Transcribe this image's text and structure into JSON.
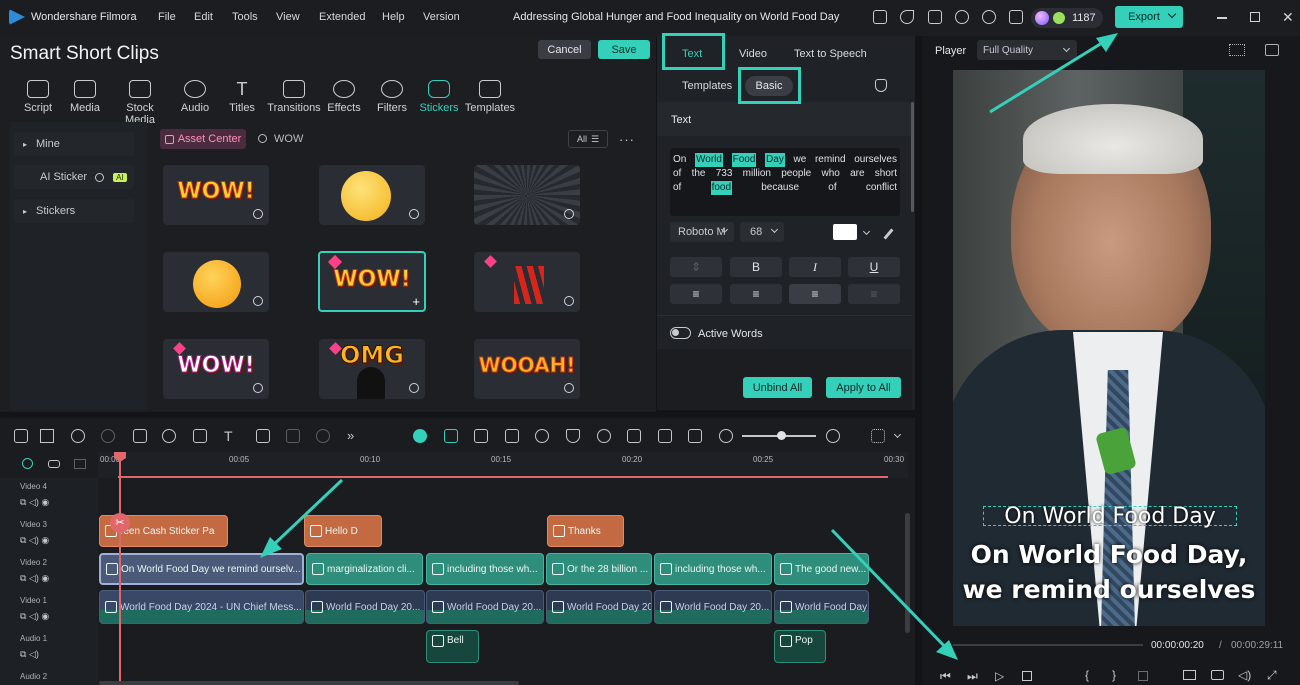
{
  "app": {
    "name": "Wondershare Filmora",
    "project_title": "Addressing Global Hunger and Food Inequality on World Food Day",
    "credits": "1187",
    "export_label": "Export"
  },
  "menu": [
    "File",
    "Edit",
    "Tools",
    "View",
    "Extended",
    "Help",
    "Version"
  ],
  "ssc": {
    "title": "Smart Short Clips",
    "cancel": "Cancel",
    "save": "Save"
  },
  "toolbar": [
    "Script",
    "Media",
    "Stock Media",
    "Audio",
    "Titles",
    "Transitions",
    "Effects",
    "Filters",
    "Stickers",
    "Templates"
  ],
  "sidebar": {
    "mine": "Mine",
    "ai_sticker": "AI Sticker",
    "ai_badge": "AI",
    "stickers": "Stickers"
  },
  "search": {
    "asset_center": "Asset Center",
    "query": "WOW",
    "filter": "All"
  },
  "stickers": [
    "WOW!",
    "",
    "",
    "",
    "WOW!",
    "",
    "WOW!",
    "OMG",
    "WOOAH!"
  ],
  "text_panel": {
    "tabs": [
      "Text",
      "Video",
      "Text to Speech"
    ],
    "subtabs": [
      "Templates",
      "Basic"
    ],
    "section": "Text",
    "words": [
      {
        "w": "On",
        "hl": false
      },
      {
        "w": "World",
        "hl": true
      },
      {
        "w": "Food",
        "hl": true
      },
      {
        "w": "Day",
        "hl": true
      },
      {
        "w": "we",
        "hl": false
      },
      {
        "w": "remind",
        "hl": false
      },
      {
        "w": "ourselves",
        "hl": false
      },
      {
        "w": "of",
        "hl": false
      },
      {
        "w": "the",
        "hl": false
      },
      {
        "w": "733",
        "hl": false
      },
      {
        "w": "million",
        "hl": false
      },
      {
        "w": "people",
        "hl": false
      },
      {
        "w": "who",
        "hl": false
      },
      {
        "w": "are",
        "hl": false
      },
      {
        "w": "short",
        "hl": false
      },
      {
        "w": "of",
        "hl": false
      },
      {
        "w": "food",
        "hl": true
      },
      {
        "w": "because",
        "hl": false
      },
      {
        "w": "of",
        "hl": false
      },
      {
        "w": "conflict",
        "hl": false
      }
    ],
    "font": "Roboto M",
    "size": "68",
    "bold": "B",
    "italic": "I",
    "underline": "U",
    "active_words": "Active Words",
    "unbind": "Unbind All",
    "apply": "Apply to All"
  },
  "player": {
    "label": "Player",
    "quality": "Full Quality",
    "caption_top": "On World Food Day",
    "caption_line1": "On World Food Day,",
    "caption_line2": "we remind ourselves",
    "current_time": "00:00:00:20",
    "sep": "/",
    "total_time": "00:00:29:11"
  },
  "timeline": {
    "ruler": [
      "00:00",
      "00:05",
      "00:10",
      "00:15",
      "00:20",
      "00:25",
      "00:30"
    ],
    "tracks": [
      "Video 4",
      "Video 3",
      "Video 2",
      "Video 1",
      "Audio 1",
      "Audio 2"
    ],
    "video3": [
      "reen Cash Sticker Pa",
      "Hello D",
      "Thanks"
    ],
    "video2": [
      "On World Food Day we remind ourselv...",
      "marginalization cli...",
      "including those wh...",
      "Or the 28 billion ...",
      "including those wh...",
      "The good new..."
    ],
    "video1": [
      "World Food Day 2024 - UN Chief Mess...",
      "World Food Day 20...",
      "World Food Day 20...",
      "World Food Day 20...",
      "World Food Day 20...",
      "World Food Day 20..."
    ],
    "audio1": [
      "Bell",
      "Pop"
    ]
  },
  "colors": {
    "accent": "#35d0ba",
    "orange_clip": "#c46a43",
    "teal_clip": "#2f8d7c"
  }
}
